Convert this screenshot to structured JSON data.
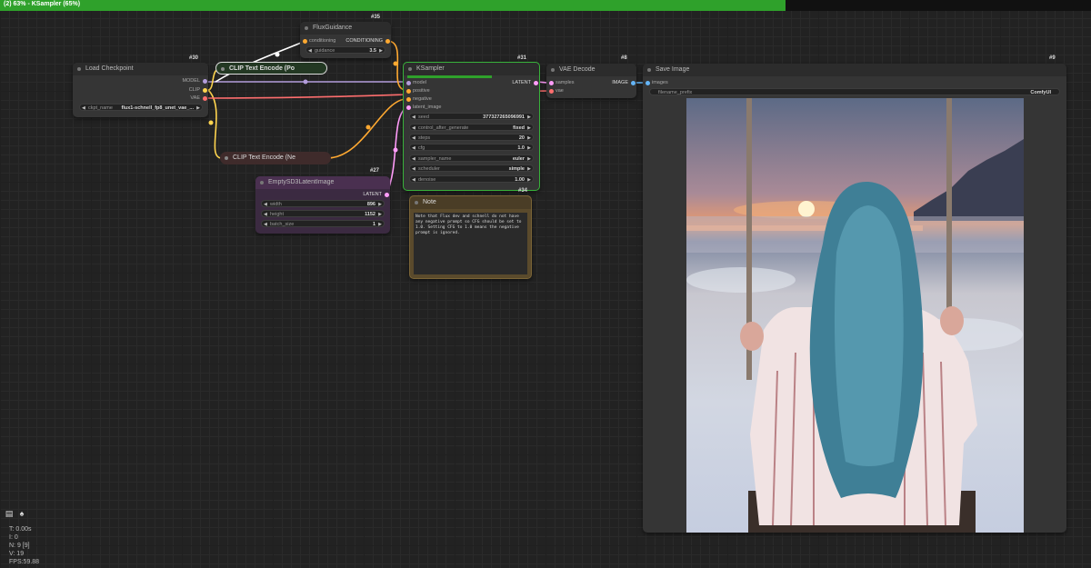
{
  "window": {
    "title": "(2) 63% - KSampler (65%)"
  },
  "nodes": {
    "load_checkpoint": {
      "id": "#30",
      "title": "Load Checkpoint",
      "outputs": [
        "MODEL",
        "CLIP",
        "VAE"
      ],
      "ckpt_name_label": "ckpt_name",
      "ckpt_name_value": "flux1-schnell_fp8_unet_vae_..."
    },
    "clip_pos": {
      "title": "CLIP Text Encode (Po"
    },
    "clip_neg": {
      "title": "CLIP Text Encode (Ne"
    },
    "flux_guidance": {
      "id": "#35",
      "title": "FluxGuidance",
      "input": "conditioning",
      "output": "CONDITIONING",
      "guidance_label": "guidance",
      "guidance_value": "3.5"
    },
    "empty_latent": {
      "id": "#27",
      "title": "EmptySD3LatentImage",
      "output": "LATENT",
      "widgets": [
        {
          "label": "width",
          "value": "896"
        },
        {
          "label": "height",
          "value": "1152"
        },
        {
          "label": "batch_size",
          "value": "1"
        }
      ]
    },
    "ksampler": {
      "id": "#31",
      "title": "KSampler",
      "inputs": [
        "model",
        "positive",
        "negative",
        "latent_image"
      ],
      "output": "LATENT",
      "widgets": [
        {
          "label": "seed",
          "value": "377327265096991"
        },
        {
          "label": "control_after_generate",
          "value": "fixed"
        },
        {
          "label": "steps",
          "value": "20"
        },
        {
          "label": "cfg",
          "value": "1.0"
        },
        {
          "label": "sampler_name",
          "value": "euler"
        },
        {
          "label": "scheduler",
          "value": "simple"
        },
        {
          "label": "denoise",
          "value": "1.00"
        }
      ],
      "progress": 0.65
    },
    "note": {
      "id": "#34",
      "title": "Note",
      "text": "Note that Flux dev and schnell do not have any negative prompt so CFG should be set to 1.0. Setting CFG to 1.0 means the negative prompt is ignored."
    },
    "vae_decode": {
      "id": "#8",
      "title": "VAE Decode",
      "inputs": [
        "samples",
        "vae"
      ],
      "output": "IMAGE"
    },
    "save_image": {
      "id": "#9",
      "title": "Save Image",
      "input": "images",
      "prefix_label": "filename_prefix",
      "prefix_value": "ComfyUI"
    }
  },
  "stats": {
    "t": "T: 0.00s",
    "i": "I: 0",
    "n": "N: 9 [9]",
    "v": "V: 19",
    "fps": "FPS:59.88"
  },
  "colors": {
    "progress_green": "#2fa12b",
    "model_wire": "#b39ddb",
    "clip_wire": "#ffd54f",
    "vae_wire": "#ff6e6e",
    "latent_wire": "#ff9cf9",
    "conditioning_wire": "#ffa931",
    "image_wire": "#64b5f6",
    "latent_node": "#442d4d",
    "note_node": "#4a3d26",
    "clip_pos_node": "#233823",
    "clip_neg_node": "#3f2b2b"
  }
}
